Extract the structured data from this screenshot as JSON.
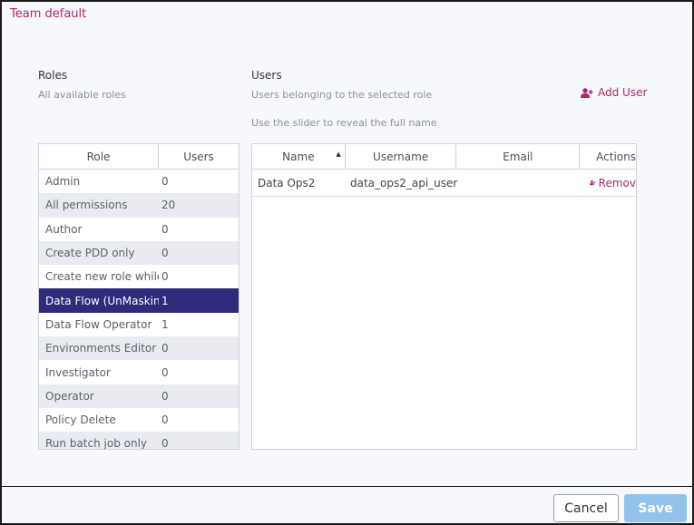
{
  "dialog": {
    "title": "Team default"
  },
  "roles_section": {
    "title": "Roles",
    "subtitle": "All available roles",
    "columns": [
      "Role",
      "Users"
    ],
    "rows": [
      {
        "role": "Admin",
        "users": "0"
      },
      {
        "role": "All permissions",
        "users": "20"
      },
      {
        "role": "Author",
        "users": "0"
      },
      {
        "role": "Create PDD only",
        "users": "0"
      },
      {
        "role": "Create new role while p",
        "users": "0"
      },
      {
        "role": "Data Flow (UnMasking)",
        "users": "1"
      },
      {
        "role": "Data Flow Operator",
        "users": "1"
      },
      {
        "role": "Environments Editor",
        "users": "0"
      },
      {
        "role": "Investigator",
        "users": "0"
      },
      {
        "role": "Operator",
        "users": "0"
      },
      {
        "role": "Policy Delete",
        "users": "0"
      },
      {
        "role": "Run batch job only",
        "users": "0"
      }
    ]
  },
  "users_section": {
    "title": "Users",
    "subtitle": "Users belonging to the selected role",
    "hint": "Use the slider to reveal the full name",
    "add_user_label": "Add User",
    "columns": [
      "Name",
      "Username",
      "Email",
      "Actions"
    ],
    "rows": [
      {
        "name": "Data Ops2",
        "username": "data_ops2_api_user",
        "email": "",
        "action": "Remov"
      }
    ]
  },
  "footer": {
    "cancel_label": "Cancel",
    "save_label": "Save"
  },
  "colors": {
    "accent": "#b0266a",
    "selected_row": "#2e2a7c",
    "save_button": "#93c3ec"
  }
}
